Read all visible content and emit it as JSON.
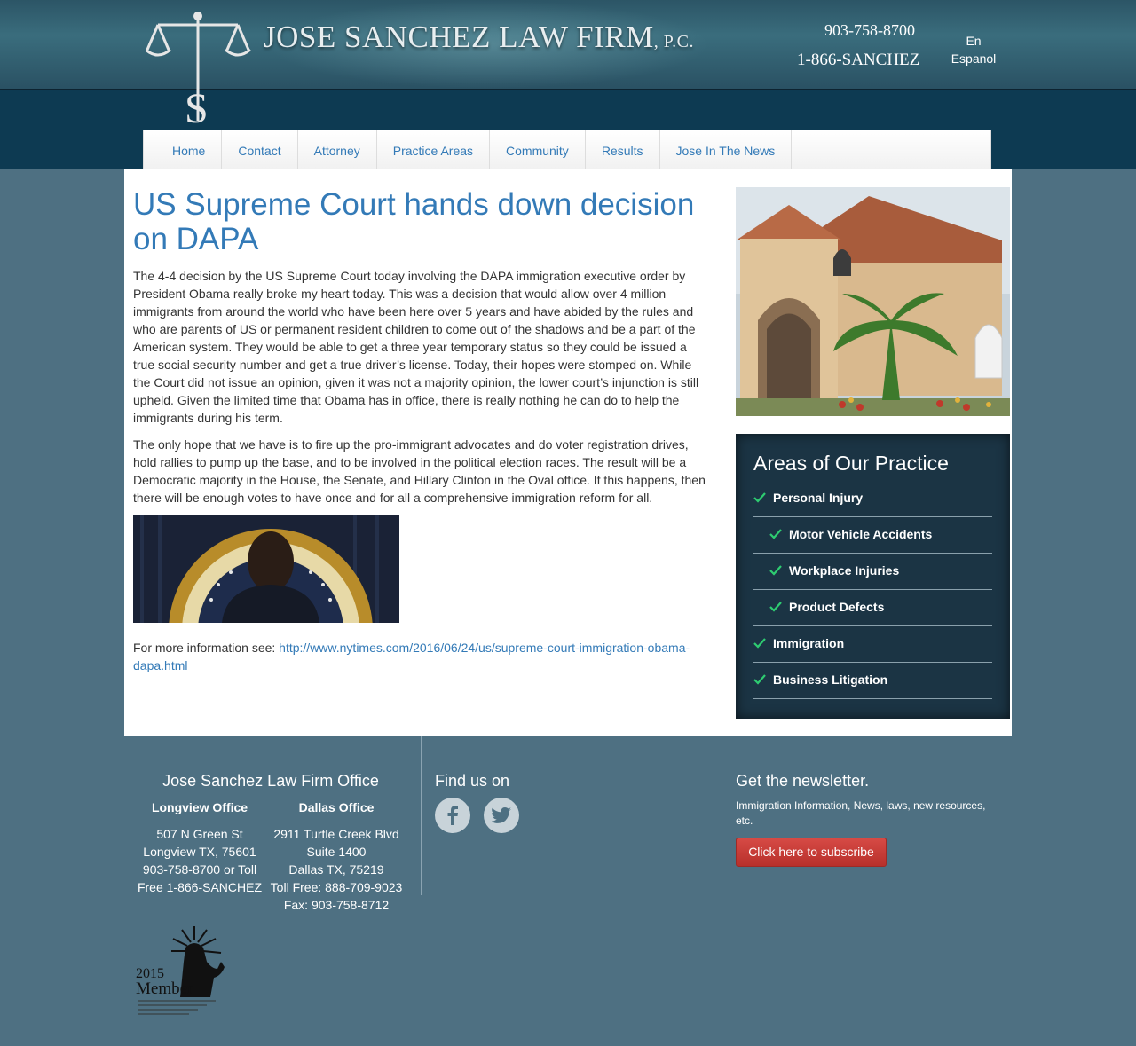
{
  "header": {
    "firm_name": "JOSE SANCHEZ LAW FIRM",
    "firm_suffix": ", P.C.",
    "phone_primary": "903-758-8700",
    "phone_toll_free": "1-866-SANCHEZ",
    "lang_en": "En",
    "lang_es": "Espanol"
  },
  "nav": {
    "items": [
      "Home",
      "Contact",
      "Attorney",
      "Practice Areas",
      "Community",
      "Results",
      "Jose In The News"
    ]
  },
  "article": {
    "title": "US Supreme Court hands down decision on DAPA",
    "para1": "The 4-4 decision by the US Supreme Court today involving the DAPA immigration executive order by President Obama really broke my heart today. This was a decision that would allow over 4 million immigrants from around the world who have been here over 5 years and have abided by the rules and who are parents of US or permanent resident children to come out of the shadows and be a part of the American system. They would be able to get a three year temporary status so they could be issued a true social security number and get a true driver’s license. Today, their hopes were stomped on. While the Court did not issue an opinion, given it was not a majority opinion, the lower court’s injunction is still upheld. Given the limited time that Obama has in office, there is really nothing he can do to help the immigrants during his term.",
    "para2": "The only hope that we have is to fire up the pro-immigrant advocates and do voter registration drives, hold rallies to pump up the base, and to be involved in the political election races. The result will be a Democratic majority in the House, the Senate, and Hillary Clinton in the Oval office. If this happens, then there will be enough votes to have once and for all a comprehensive immigration reform for all.",
    "more_info_label": "For more information see: ",
    "more_info_link": "http://www.nytimes.com/2016/06/24/us/supreme-court-immigration-obama-dapa.html"
  },
  "practice": {
    "title": "Areas of Our Practice",
    "items": [
      {
        "label": "Personal Injury",
        "sub": false
      },
      {
        "label": "Motor Vehicle Accidents",
        "sub": true
      },
      {
        "label": "Workplace Injuries",
        "sub": true
      },
      {
        "label": "Product Defects",
        "sub": true
      },
      {
        "label": "Immigration",
        "sub": false
      },
      {
        "label": "Business Litigation",
        "sub": false
      }
    ]
  },
  "footer": {
    "office_title": "Jose Sanchez Law Firm Office",
    "longview": {
      "name": "Longview Office",
      "address": "507 N Green St Longview TX, 75601 903-758-8700 or Toll Free 1-866-SANCHEZ"
    },
    "dallas": {
      "name": "Dallas Office",
      "line1": "2911 Turtle Creek Blvd",
      "line2": "Suite 1400",
      "line3": "Dallas TX, 75219",
      "line4": "Toll Free: 888-709-9023",
      "line5": "Fax: 903-758-8712"
    },
    "find_us": "Find us on",
    "newsletter_title": "Get the newsletter.",
    "newsletter_desc": "Immigration Information, News, laws, new resources, etc.",
    "subscribe_label": "Click here to subscribe",
    "badge_year": "2015",
    "badge_word": "Member"
  },
  "colors": {
    "link": "#337ab7",
    "header_dark": "#0d3a52",
    "practice_bg": "#1b3444",
    "footer_bg": "#4e7082",
    "check_green": "#2ecc71",
    "subscribe_red": "#c9302c"
  }
}
